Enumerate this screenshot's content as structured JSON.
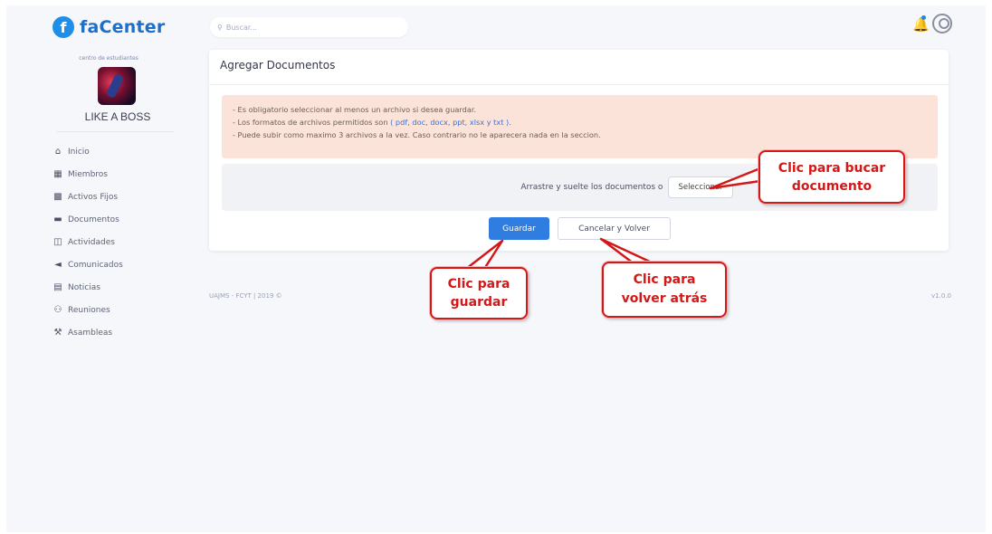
{
  "brand": {
    "logo_letter": "f",
    "name": "faCenter"
  },
  "sidebar": {
    "org_subtitle": "centro de estudiantes",
    "org_name": "LIKE A BOSS",
    "items": [
      {
        "label": "Inicio",
        "icon": "home-icon"
      },
      {
        "label": "Miembros",
        "icon": "members-icon"
      },
      {
        "label": "Activos Fijos",
        "icon": "assets-icon"
      },
      {
        "label": "Documentos",
        "icon": "folder-icon"
      },
      {
        "label": "Actividades",
        "icon": "activities-icon"
      },
      {
        "label": "Comunicados",
        "icon": "megaphone-icon"
      },
      {
        "label": "Noticias",
        "icon": "news-icon"
      },
      {
        "label": "Reuniones",
        "icon": "meeting-icon"
      },
      {
        "label": "Asambleas",
        "icon": "assembly-icon"
      }
    ]
  },
  "search": {
    "placeholder": "Buscar..."
  },
  "card": {
    "title": "Agregar Documentos",
    "alert": {
      "line1": "- Es obligatorio seleccionar al menos un archivo si desea guardar.",
      "line2_pre": "- Los formatos de archivos permitidos son",
      "line2_link": "( pdf, doc, docx, ppt, xlsx y txt )",
      "line2_post": ".",
      "line3": "- Puede subir como maximo 3 archivos a la vez. Caso contrario no le aparecera nada en la seccion."
    },
    "drop_text": "Arrastre y suelte los documentos o",
    "select_button": "Seleccionar",
    "save_button": "Guardar",
    "cancel_button": "Cancelar y Volver"
  },
  "footer": {
    "left": "UAJMS - FCYT | 2019 ©",
    "right": "v1.0.0"
  },
  "annotations": {
    "select": {
      "line1": "Clic para bucar",
      "line2": "documento"
    },
    "save": {
      "line1": "Clic para",
      "line2": "guardar"
    },
    "cancel": {
      "line1": "Clic para",
      "line2": "volver atrás"
    }
  },
  "colors": {
    "accent": "#2f7de1",
    "brand": "#1d6fc9",
    "alert_bg": "#fce3d9",
    "annotation": "#d41818"
  }
}
